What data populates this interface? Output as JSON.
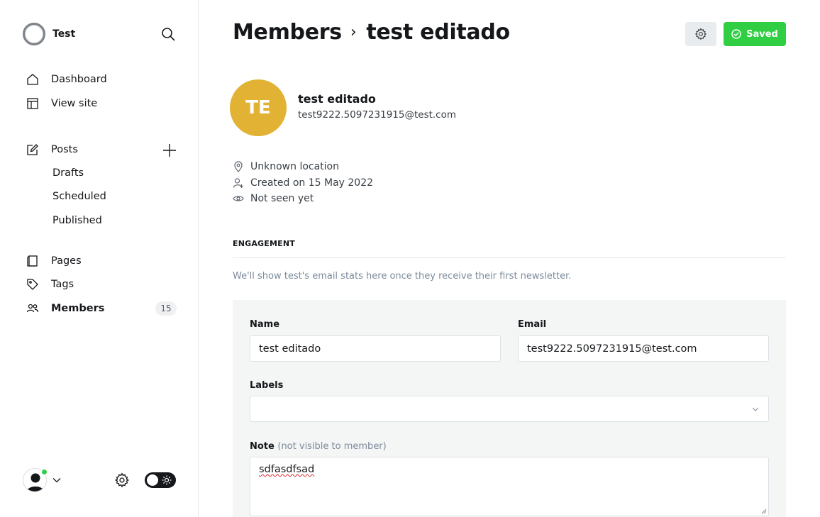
{
  "sidebar": {
    "site_name": "Test",
    "nav": {
      "dashboard": "Dashboard",
      "view_site": "View site",
      "posts": "Posts",
      "drafts": "Drafts",
      "scheduled": "Scheduled",
      "published": "Published",
      "pages": "Pages",
      "tags": "Tags",
      "members": "Members",
      "members_count": "15"
    }
  },
  "header": {
    "breadcrumb_parent": "Members",
    "breadcrumb_separator": "›",
    "breadcrumb_current": "test editado",
    "saved_label": "Saved"
  },
  "member": {
    "initials": "TE",
    "name": "test editado",
    "email": "test9222.5097231915@test.com",
    "avatar_color": "#e1b233",
    "location": "Unknown location",
    "created": "Created on 15 May 2022",
    "last_seen": "Not seen yet"
  },
  "engagement": {
    "title": "ENGAGEMENT",
    "note": "We'll show test's email stats here once they receive their first newsletter."
  },
  "form": {
    "name_label": "Name",
    "name_value": "test editado",
    "email_label": "Email",
    "email_value": "test9222.5097231915@test.com",
    "labels_label": "Labels",
    "labels_value": "",
    "note_label": "Note",
    "note_hint": "(not visible to member)",
    "note_value": "sdfasdfsad"
  },
  "colors": {
    "accent_green": "#30cf43",
    "online_dot": "#30cf43"
  }
}
